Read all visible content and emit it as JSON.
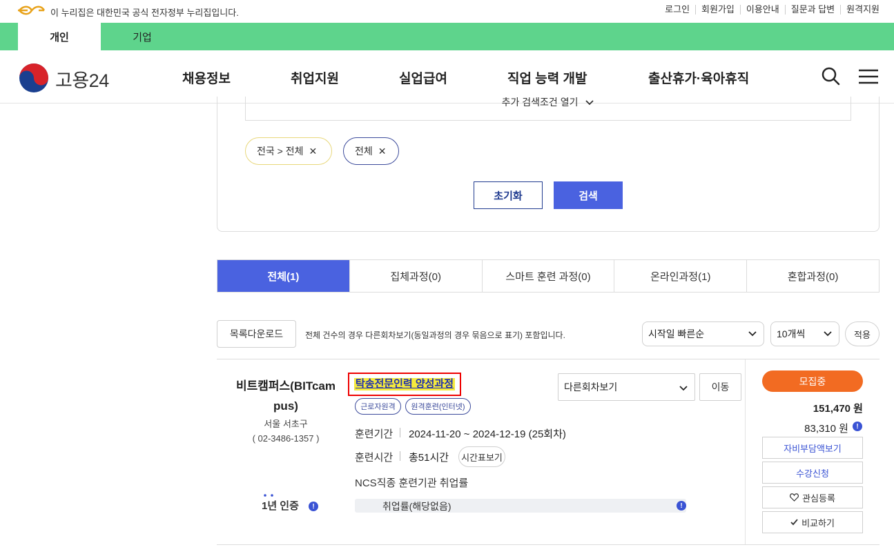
{
  "gov_bar": {
    "notice": "이 누리집은 대한민국 공식 전자정부 누리집입니다.",
    "links": [
      "로그인",
      "회원가입",
      "이용안내",
      "질문과 답변",
      "원격지원"
    ]
  },
  "user_tabs": [
    "개인",
    "기업"
  ],
  "header": {
    "logo_text": "고용24",
    "nav": [
      "채용정보",
      "취업지원",
      "실업급여",
      "직업 능력 개발",
      "출산휴가·육아휴직"
    ]
  },
  "search": {
    "more_conditions": "추가 검색조건 열기",
    "chips": [
      "전국 > 전체",
      "전체"
    ],
    "reset_label": "초기화",
    "search_label": "검색"
  },
  "course_tabs": [
    "전체(1)",
    "집체과정(0)",
    "스마트 훈련 과정(0)",
    "온라인과정(1)",
    "혼합과정(0)"
  ],
  "list": {
    "download_label": "목록다운로드",
    "note": "전체 건수의 경우 다른회차보기(동일과정의 경우 묶음으로 표기) 포함입니다.",
    "sort_selected": "시작일 빠른순",
    "count_selected": "10개씩",
    "apply_label": "적용"
  },
  "course": {
    "institution": "비트캠퍼스(BITcampus)",
    "institution_line1": "비트캠퍼스(BITcam",
    "institution_line2": "pus)",
    "location": "서울 서초구",
    "phone": "( 02-3486-1357 )",
    "cert": "1년 인증",
    "title": "탁송전문인력 양성과정",
    "tags": [
      "근로자원격",
      "원격훈련(인터넷)"
    ],
    "period_label": "훈련기간",
    "period_value": "2024-11-20 ~ 2024-12-19 (25회차)",
    "hours_label": "훈련시간",
    "hours_value": "총51시간",
    "timetable_label": "시간표보기",
    "ncs_label": "NCS직종 훈련기관 취업률",
    "employment_rate": "취업률(해당없음)",
    "session_selected": "다른회차보기",
    "move_label": "이동",
    "status": "모집중",
    "price": "151,470 원",
    "self_pay": "83,310 원",
    "self_pay_btn": "자비부담액보기",
    "apply_btn": "수강신청",
    "favorite_btn": "관심등록",
    "compare_btn": "비교하기"
  },
  "colors": {
    "green_bar": "#5ed48c",
    "primary_blue": "#4a62e0",
    "status_orange": "#f26b22",
    "highlight_yellow": "#f5ea3c",
    "annotation_red": "#ee0000"
  }
}
